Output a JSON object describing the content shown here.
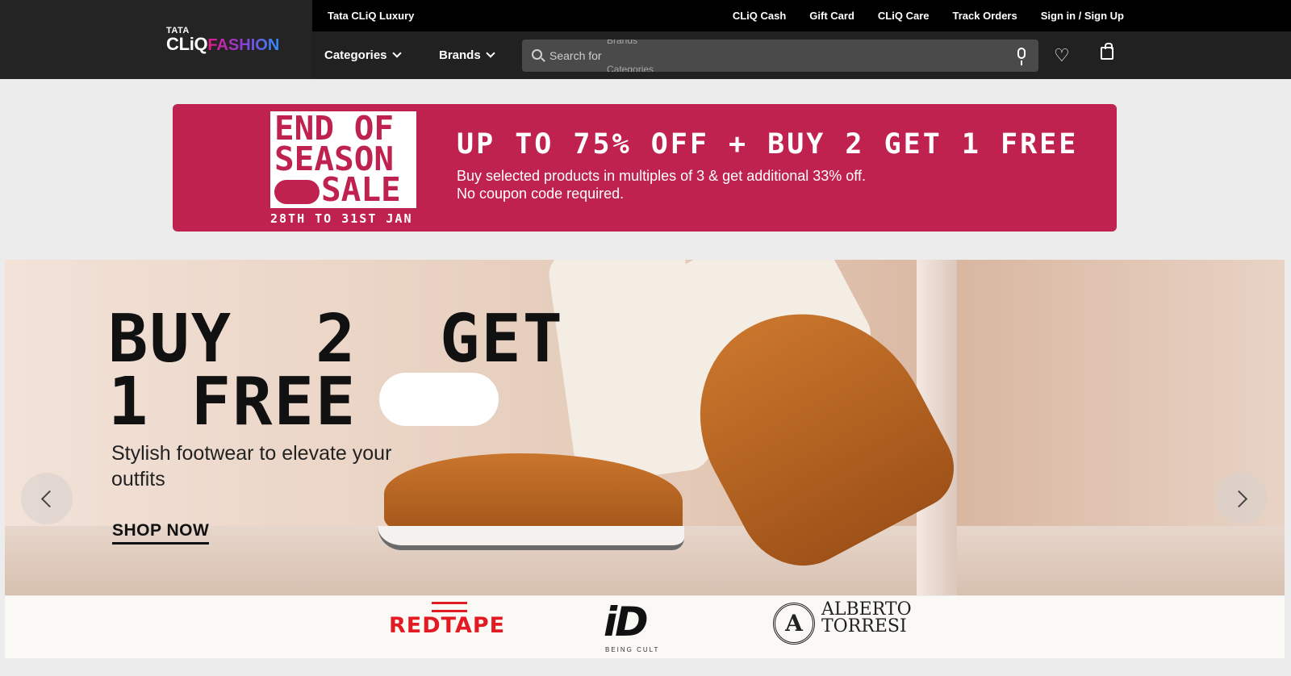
{
  "header": {
    "logo_top": "TATA",
    "logo_cliq": "CLiQ",
    "logo_fashion": "FASHION",
    "luxury_link": "Tata CLiQ Luxury",
    "top_links": [
      "CLiQ Cash",
      "Gift Card",
      "CLiQ Care",
      "Track Orders",
      "Sign in / Sign Up"
    ],
    "nav": {
      "categories": "Categories",
      "brands": "Brands"
    },
    "search": {
      "placeholder": "Search for",
      "rolling_prev": "Brands",
      "rolling_next": "Categories"
    },
    "icons": [
      "search-icon",
      "microphone-icon",
      "heart-icon",
      "shopping-bag-icon"
    ]
  },
  "sale_banner": {
    "box_line1": "END OF",
    "box_line2": "SEASON",
    "box_line3": "SALE",
    "dates": "28TH TO 31ST JAN",
    "headline": "UP TO 75% OFF + BUY 2 GET 1 FREE",
    "subline1": "Buy selected products in multiples of 3 & get additional 33% off.",
    "subline2": "No coupon code required.",
    "color": "#c0224f"
  },
  "hero": {
    "title": "BUY  2  GET\n1 FREE",
    "subtitle": "Stylish footwear to elevate your outfits",
    "cta": "SHOP NOW",
    "prev_icon": "chevron-left-icon",
    "next_icon": "chevron-right-icon"
  },
  "brand_strip": {
    "redtape": "REDTAPE",
    "id_logo": "iD",
    "id_sub": "BEING CULT",
    "alberto_seal": "A",
    "alberto_line1": "ALBERTO",
    "alberto_line2": "TORRESI"
  }
}
